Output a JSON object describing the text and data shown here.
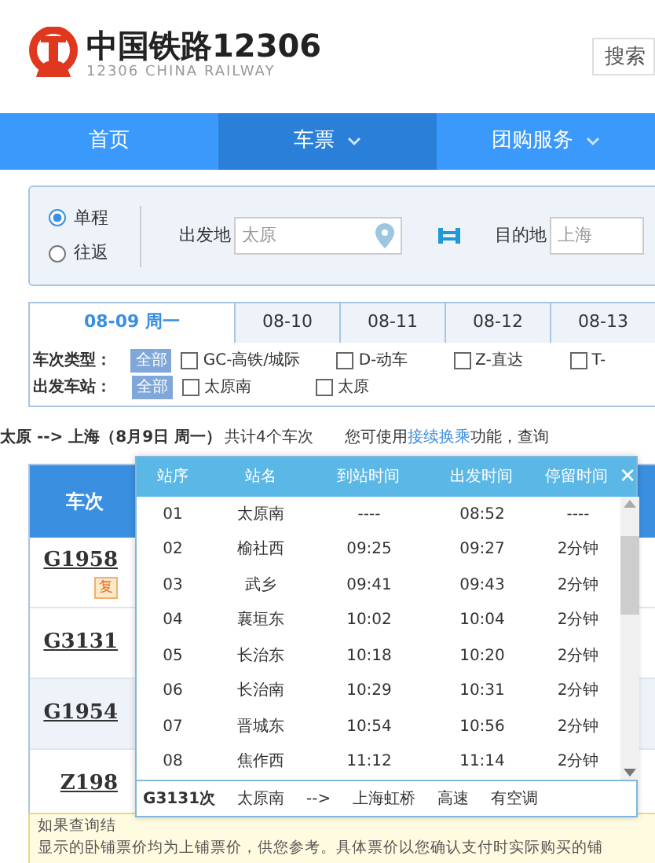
{
  "logo": {
    "title": "中国铁路12306",
    "subtitle": "12306 CHINA RAILWAY"
  },
  "search": {
    "placeholder": "搜索"
  },
  "nav": [
    {
      "label": "首页",
      "selected": false,
      "dropdown": false
    },
    {
      "label": "车票",
      "selected": true,
      "dropdown": true
    },
    {
      "label": "团购服务",
      "selected": false,
      "dropdown": true
    }
  ],
  "trip_type": [
    {
      "label": "单程",
      "selected": true
    },
    {
      "label": "往返",
      "selected": false
    }
  ],
  "from": {
    "label": "出发地",
    "value": "太原"
  },
  "to": {
    "label": "目的地",
    "value": "上海"
  },
  "date_tabs": [
    {
      "label": "08-09 周一",
      "selected": true
    },
    {
      "label": "08-10",
      "selected": false
    },
    {
      "label": "08-11",
      "selected": false
    },
    {
      "label": "08-12",
      "selected": false
    },
    {
      "label": "08-13",
      "selected": false
    }
  ],
  "filters": [
    {
      "label": "车次类型：",
      "all": "全部",
      "options": [
        {
          "label": "GC-高铁/城际",
          "checked": false
        },
        {
          "label": "D-动车",
          "checked": false
        },
        {
          "label": "Z-直达",
          "checked": false
        },
        {
          "label": "T-",
          "checked": false
        }
      ]
    },
    {
      "label": "出发车站：",
      "all": "全部",
      "options": [
        {
          "label": "太原南",
          "checked": false
        },
        {
          "label": "太原",
          "checked": false
        }
      ]
    }
  ],
  "summary": {
    "route": "太原 --> 上海（8月9日 周一）",
    "count": "共计4个车次",
    "hint_before": "您可使用",
    "hint_link": "接续换乘",
    "hint_after": "功能，查询"
  },
  "table": {
    "column": "车次",
    "rows": [
      {
        "train": "G1958",
        "badge": "复"
      },
      {
        "train": "G3131"
      },
      {
        "train": "G1954"
      },
      {
        "train": "Z198"
      }
    ]
  },
  "popup": {
    "columns": [
      "站序",
      "站名",
      "到站时间",
      "出发时间",
      "停留时间"
    ],
    "close": "✕",
    "rows": [
      [
        "01",
        "太原南",
        "----",
        "08:52",
        "----"
      ],
      [
        "02",
        "榆社西",
        "09:25",
        "09:27",
        "2分钟"
      ],
      [
        "03",
        "武乡",
        "09:41",
        "09:43",
        "2分钟"
      ],
      [
        "04",
        "襄垣东",
        "10:02",
        "10:04",
        "2分钟"
      ],
      [
        "05",
        "长治东",
        "10:18",
        "10:20",
        "2分钟"
      ],
      [
        "06",
        "长治南",
        "10:29",
        "10:31",
        "2分钟"
      ],
      [
        "07",
        "晋城东",
        "10:54",
        "10:56",
        "2分钟"
      ],
      [
        "08",
        "焦作西",
        "11:12",
        "11:14",
        "2分钟"
      ]
    ],
    "footer": [
      "G3131次",
      "太原南",
      "-->",
      "上海虹桥",
      "高速",
      "有空调"
    ]
  },
  "notice": [
    "如果查询结",
    "显示的卧铺票价均为上铺票价，供您参考。具体票价以您确认支付时实际购买的铺"
  ]
}
